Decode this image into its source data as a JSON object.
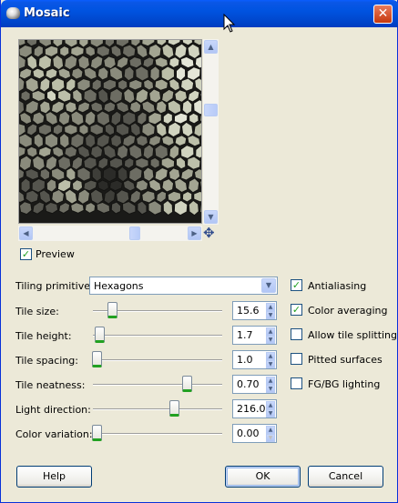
{
  "window": {
    "title": "Mosaic",
    "close_glyph": "✕"
  },
  "preview": {
    "checkbox_label": "Preview",
    "checked": true,
    "palette": [
      "#2b2b28",
      "#3e3e39",
      "#55554e",
      "#6d6d63",
      "#8a8b7c",
      "#a3a592",
      "#bcbfa9",
      "#d1d4c0",
      "#e4e6d7"
    ]
  },
  "tiling": {
    "label": "Tiling primitives:",
    "value": "Hexagons"
  },
  "sliders": [
    {
      "label": "Tile size:",
      "value": "15.6",
      "fraction": 0.12,
      "down_disabled": false
    },
    {
      "label": "Tile height:",
      "value": "1.7",
      "fraction": 0.02,
      "down_disabled": false
    },
    {
      "label": "Tile spacing:",
      "value": "1.0",
      "fraction": 0.0,
      "down_disabled": false
    },
    {
      "label": "Tile neatness:",
      "value": "0.70",
      "fraction": 0.7,
      "down_disabled": false
    },
    {
      "label": "Light direction:",
      "value": "216.0",
      "fraction": 0.6,
      "down_disabled": false
    },
    {
      "label": "Color variation:",
      "value": "0.00",
      "fraction": 0.0,
      "down_disabled": true
    }
  ],
  "options": [
    {
      "label": "Antialiasing",
      "checked": true
    },
    {
      "label": "Color averaging",
      "checked": true
    },
    {
      "label": "Allow tile splitting",
      "checked": false
    },
    {
      "label": "Pitted surfaces",
      "checked": false
    },
    {
      "label": "FG/BG lighting",
      "checked": false
    }
  ],
  "buttons": {
    "help": "Help",
    "ok": "OK",
    "cancel": "Cancel"
  },
  "colors": {
    "titlebar": "#0053e0",
    "dialog_bg": "#ece9d8",
    "check_green": "#21a121"
  },
  "icons": {
    "title": "gimp-icon",
    "close": "close-icon",
    "scroll_up": "arrow-up-icon",
    "scroll_down": "arrow-down-icon",
    "scroll_left": "arrow-left-icon",
    "scroll_right": "arrow-right-icon",
    "navigate": "navigate-icon",
    "combo": "chevron-down-icon"
  }
}
